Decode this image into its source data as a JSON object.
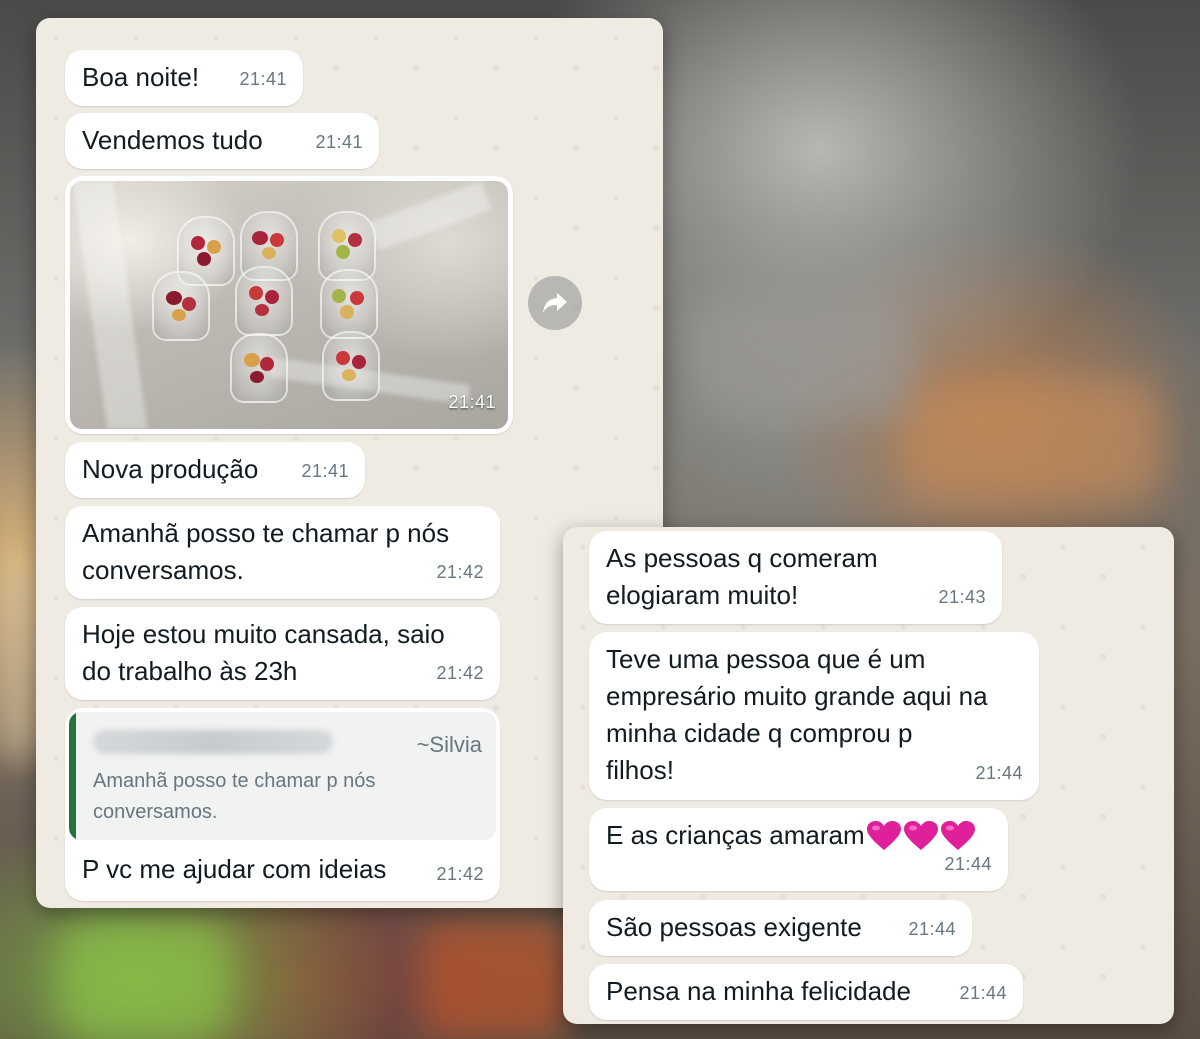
{
  "left_panel": {
    "messages": [
      {
        "text": "Boa noite!",
        "time": "21:41"
      },
      {
        "text": "Vendemos tudo",
        "time": "21:41"
      },
      {
        "type": "image",
        "time": "21:41",
        "description_icon": "forward-icon"
      },
      {
        "text": "Nova produção",
        "time": "21:41"
      },
      {
        "text": "Amanhã posso te chamar p nós\nconversamos.",
        "time": "21:42"
      },
      {
        "text": "Hoje estou muito cansada, saio\ndo trabalho às 23h",
        "time": "21:42"
      },
      {
        "quote": {
          "author": "~Silvia",
          "text": "Amanhã posso te chamar p nós\nconversamos."
        },
        "text": "P vc me ajudar com ideias",
        "time": "21:42"
      }
    ]
  },
  "right_panel": {
    "messages": [
      {
        "text": "As pessoas q comeram\nelogiaram muito!",
        "time": "21:43"
      },
      {
        "text": "Teve uma pessoa que é um\nempresário muito grande aqui na\nminha cidade q comprou p\nfilhos!",
        "time": "21:44"
      },
      {
        "text": "E as crianças amaram",
        "emoji": [
          "pink-heart",
          "pink-heart",
          "pink-heart"
        ],
        "time": "21:44"
      },
      {
        "text": "São pessoas exigente",
        "time": "21:44"
      },
      {
        "text": "Pensa na minha felicidade",
        "time": "21:44"
      }
    ]
  },
  "colors": {
    "chat_background": "#efeae2",
    "bubble": "#ffffff",
    "time_text": "#667781",
    "quote_bar": "#25733f",
    "heart": "#e0209a"
  }
}
